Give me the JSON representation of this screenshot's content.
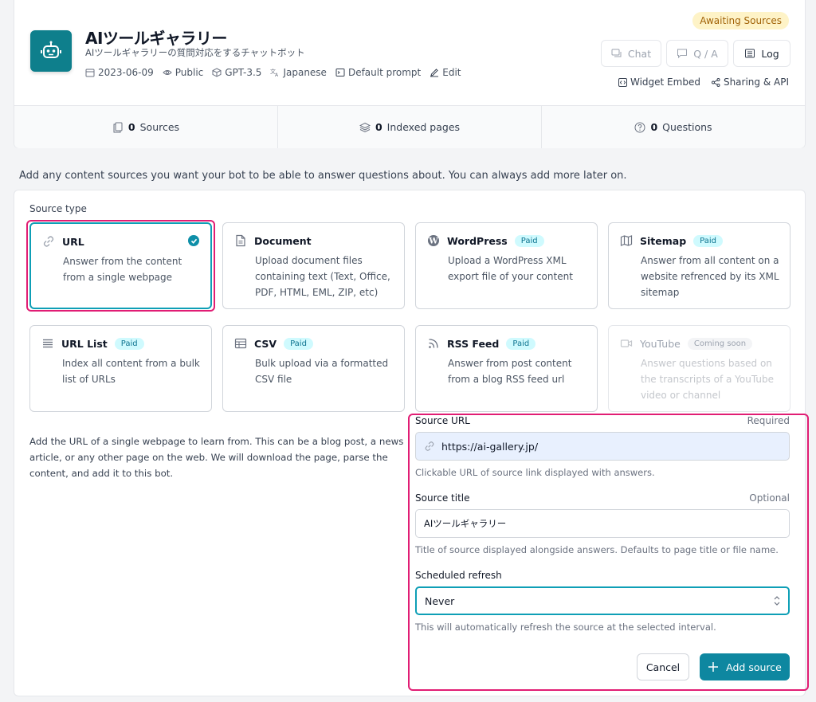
{
  "bot": {
    "title": "AIツールギャラリー",
    "description": "AIツールギャラリーの質問対応をするチャットボット",
    "meta": {
      "date": "2023-06-09",
      "visibility": "Public",
      "model": "GPT-3.5",
      "language": "Japanese",
      "prompt": "Default prompt",
      "edit": "Edit"
    }
  },
  "header": {
    "status": "Awaiting Sources",
    "chat_label": "Chat",
    "qa_label": "Q / A",
    "log_label": "Log",
    "widget_label": "Widget Embed",
    "sharing_label": "Sharing & API"
  },
  "stats": {
    "sources_count": "0",
    "sources_label": "Sources",
    "pages_count": "0",
    "pages_label": "Indexed pages",
    "questions_count": "0",
    "questions_label": "Questions"
  },
  "intro": "Add any content sources you want your bot to be able to answer questions about. You can always add more later on.",
  "source_type_label": "Source type",
  "tiles": [
    {
      "title": "URL",
      "badge": "",
      "desc": "Answer from the content from a single webpage",
      "icon": "link-icon"
    },
    {
      "title": "Document",
      "badge": "",
      "desc": "Upload document files containing text (Text, Office, PDF, HTML, EML, ZIP, etc)",
      "icon": "document-icon"
    },
    {
      "title": "WordPress",
      "badge": "Paid",
      "desc": "Upload a WordPress XML export file of your content",
      "icon": "wordpress-icon"
    },
    {
      "title": "Sitemap",
      "badge": "Paid",
      "desc": "Answer from all content on a website refrenced by its XML sitemap",
      "icon": "map-icon"
    },
    {
      "title": "URL List",
      "badge": "Paid",
      "desc": "Index all content from a bulk list of URLs",
      "icon": "list-icon"
    },
    {
      "title": "CSV",
      "badge": "Paid",
      "desc": "Bulk upload via a formatted CSV file",
      "icon": "table-icon"
    },
    {
      "title": "RSS Feed",
      "badge": "Paid",
      "desc": "Answer from post content from a blog RSS feed url",
      "icon": "rss-icon"
    },
    {
      "title": "YouTube",
      "badge": "Coming soon",
      "desc": "Answer questions based on the transcripts of a YouTube video or channel",
      "icon": "video-icon"
    }
  ],
  "url_help": "Add the URL of a single webpage to learn from. This can be a blog post, a news article, or any other page on the web. We will download the page, parse the content, and add it to this bot.",
  "form": {
    "url_label": "Source URL",
    "url_required": "Required",
    "url_value": "https://ai-gallery.jp/",
    "url_help": "Clickable URL of source link displayed with answers.",
    "title_label": "Source title",
    "title_optional": "Optional",
    "title_value": "AIツールギャラリー",
    "title_help": "Title of source displayed alongside answers. Defaults to page title or file name.",
    "refresh_label": "Scheduled refresh",
    "refresh_value": "Never",
    "refresh_help": "This will automatically refresh the source at the selected interval.",
    "cancel_label": "Cancel",
    "add_label": "Add source"
  },
  "colors": {
    "accent": "#0e87a0",
    "highlight": "#e11d74",
    "badge_bg": "#cffafe",
    "status_bg": "#fef3c7"
  }
}
